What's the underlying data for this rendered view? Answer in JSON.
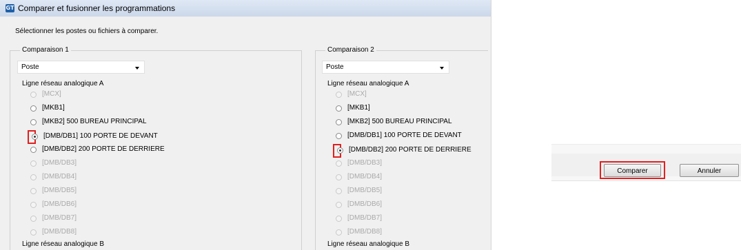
{
  "window": {
    "title": "Comparer et fusionner les programmations",
    "app_icon": "GT"
  },
  "instruction": "Sélectionner les postes ou fichiers à comparer.",
  "comparisons": [
    {
      "title": "Comparaison 1",
      "type_select": "Poste",
      "section_a": "Ligne réseau analogique A",
      "section_b": "Ligne réseau analogique B",
      "stations": [
        {
          "label": "[MCX]",
          "enabled": false,
          "checked": false
        },
        {
          "label": "[MKB1]",
          "enabled": true,
          "checked": false
        },
        {
          "label": "[MKB2] 500 BUREAU PRINCIPAL",
          "enabled": true,
          "checked": false
        },
        {
          "label": "[DMB/DB1] 100 PORTE DE DEVANT",
          "enabled": true,
          "checked": true
        },
        {
          "label": "[DMB/DB2] 200 PORTE DE DERRIERE",
          "enabled": true,
          "checked": false
        },
        {
          "label": "[DMB/DB3]",
          "enabled": false,
          "checked": false
        },
        {
          "label": "[DMB/DB4]",
          "enabled": false,
          "checked": false
        },
        {
          "label": "[DMB/DB5]",
          "enabled": false,
          "checked": false
        },
        {
          "label": "[DMB/DB6]",
          "enabled": false,
          "checked": false
        },
        {
          "label": "[DMB/DB7]",
          "enabled": false,
          "checked": false
        },
        {
          "label": "[DMB/DB8]",
          "enabled": false,
          "checked": false
        }
      ]
    },
    {
      "title": "Comparaison 2",
      "type_select": "Poste",
      "section_a": "Ligne réseau analogique A",
      "section_b": "Ligne réseau analogique B",
      "stations": [
        {
          "label": "[MCX]",
          "enabled": false,
          "checked": false
        },
        {
          "label": "[MKB1]",
          "enabled": true,
          "checked": false
        },
        {
          "label": "[MKB2] 500 BUREAU PRINCIPAL",
          "enabled": true,
          "checked": false
        },
        {
          "label": "[DMB/DB1] 100 PORTE DE DEVANT",
          "enabled": true,
          "checked": false
        },
        {
          "label": "[DMB/DB2] 200 PORTE DE DERRIERE",
          "enabled": true,
          "checked": true
        },
        {
          "label": "[DMB/DB3]",
          "enabled": false,
          "checked": false
        },
        {
          "label": "[DMB/DB4]",
          "enabled": false,
          "checked": false
        },
        {
          "label": "[DMB/DB5]",
          "enabled": false,
          "checked": false
        },
        {
          "label": "[DMB/DB6]",
          "enabled": false,
          "checked": false
        },
        {
          "label": "[DMB/DB7]",
          "enabled": false,
          "checked": false
        },
        {
          "label": "[DMB/DB8]",
          "enabled": false,
          "checked": false
        }
      ]
    }
  ],
  "buttons": {
    "compare": "Comparer",
    "cancel": "Annuler"
  },
  "colors": {
    "highlight": "#e11f1f",
    "dialog_bg": "#f0f0f0",
    "titlebar": "#d6e2f2"
  }
}
